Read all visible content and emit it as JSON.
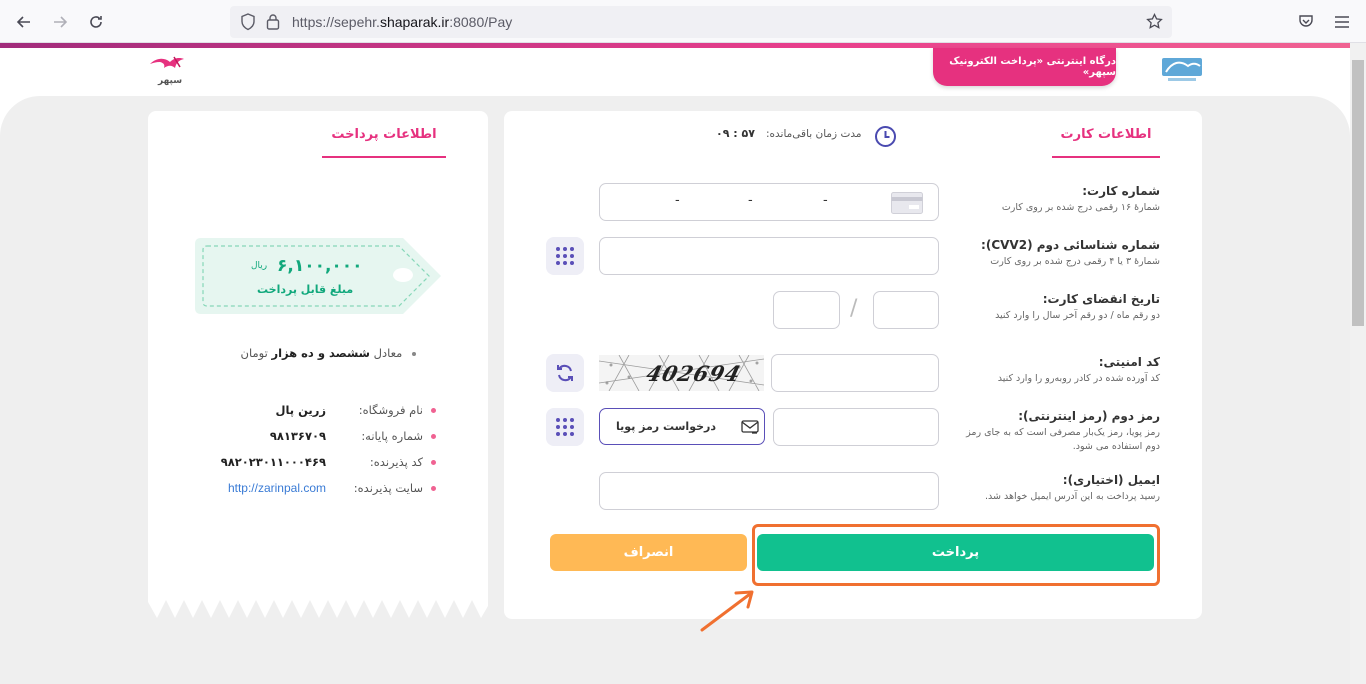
{
  "browser": {
    "url_prefix": "https://sepehr.",
    "url_host": "shaparak.ir",
    "url_suffix": ":8080/Pay"
  },
  "header": {
    "gateway_title": "درگاه اینترنتی «پرداخت الکترونیک سپهر»",
    "logo_left_text": "سپهر"
  },
  "card_panel": {
    "tab_title": "اطلاعات کارت",
    "timer_label": "مدت زمان باقی‌مانده:",
    "timer_value": "۰۹ : ۵۷",
    "card_number": {
      "label": "شماره کارت:",
      "hint": "شمارهٔ ۱۶ رقمی درج شده بر روی کارت",
      "separators": [
        "-",
        "-",
        "-"
      ]
    },
    "cvv2": {
      "label": "شماره شناسائی دوم (CVV2):",
      "hint": "شمارهٔ ۳ یا ۴ رقمی درج شده بر روی کارت"
    },
    "expiry": {
      "label": "تاریخ انقضای کارت:",
      "hint": "دو رقم ماه / دو رقم آخر سال را وارد کنید",
      "slash": "/"
    },
    "captcha": {
      "label": "کد امنیتی:",
      "hint": "کد آورده شده در کادر روبه‌رو را وارد کنید",
      "image_text": "402694"
    },
    "pin2": {
      "label": "رمز دوم (رمز اینترنتی):",
      "hint": "رمز پویا، رمز یک‌بار مصرفی است که به جای رمز دوم استفاده می شود.",
      "request_button": "درخواست رمز پویا"
    },
    "email": {
      "label": "ایمیل (اختیاری):",
      "hint": "رسید پرداخت به این آدرس ایمیل خواهد شد."
    },
    "pay_button": "پرداخت",
    "cancel_button": "انصراف"
  },
  "payment_panel": {
    "tab_title": "اطلاعات پرداخت",
    "amount": "۶,۱۰۰,۰۰۰",
    "currency": "ریال",
    "amount_label": "مبلغ قابل پرداخت",
    "equivalent_prefix": "معادل",
    "equivalent_words": "ششصد و ده هزار",
    "equivalent_unit": "تومان",
    "rows": [
      {
        "key": "نام فروشگاه:",
        "value": "زرین پال"
      },
      {
        "key": "شماره پایانه:",
        "value": "۹۸۱۳۶۷۰۹"
      },
      {
        "key": "کد پذیرنده:",
        "value": "۹۸۲۰۲۳۰۱۱۰۰۰۴۶۹"
      },
      {
        "key": "سایت پذیرنده:",
        "value": "http://zarinpal.com"
      }
    ]
  },
  "colors": {
    "brand_pink": "#e6317f",
    "pay_green": "#11c18f",
    "cancel_orange": "#ffb955",
    "highlight_orange": "#f07030",
    "accent_purple": "#5a4fb8"
  }
}
